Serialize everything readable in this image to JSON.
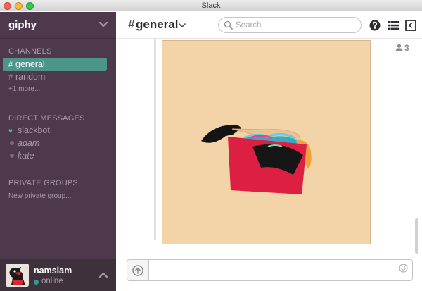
{
  "window": {
    "title": "Slack"
  },
  "sidebar": {
    "team_name": "giphy",
    "channels_title": "CHANNELS",
    "channels": [
      {
        "prefix": "#",
        "label": "general",
        "active": true
      },
      {
        "prefix": "#",
        "label": "random",
        "active": false
      }
    ],
    "channels_more": "+1 more...",
    "dm_title": "DIRECT MESSAGES",
    "direct_messages": [
      {
        "label": "slackbot",
        "status": "bot"
      },
      {
        "label": "adam",
        "status": "away"
      },
      {
        "label": "kate",
        "status": "away"
      }
    ],
    "private_title": "PRIVATE GROUPS",
    "new_private_group": "New private group...",
    "user": {
      "name": "namslam",
      "presence": "online"
    }
  },
  "header": {
    "channel_hash": "#",
    "channel_name": "general",
    "search_placeholder": "Search",
    "member_count": "3"
  },
  "colors": {
    "sidebar_bg": "#4d394b",
    "active_channel": "#4c9689",
    "gif_background": "#f3d3a8"
  }
}
